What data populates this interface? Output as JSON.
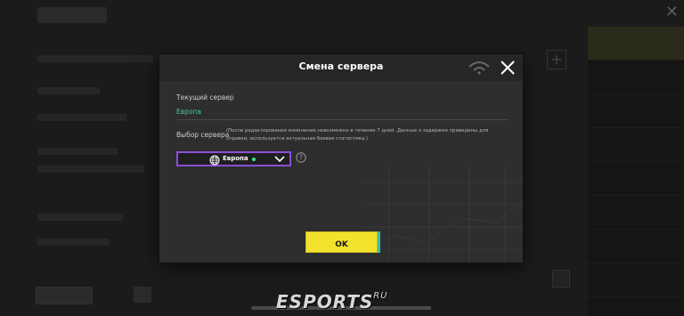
{
  "dialog": {
    "title": "Смена сервера",
    "current_server_label": "Текущий сервер",
    "current_server_value": "Европа",
    "server_select_label": "Выбор сервера",
    "server_select_note": "(После редактирования изменение невозможно в течение 7 дней. Данные о задержке приведены для справки; используется актуальная боевая статистика.)",
    "selected_server": "Европа",
    "ok_label": "OK"
  },
  "colors": {
    "accent_select_border": "#8a4fd8",
    "current_server_text": "#41d28c",
    "ok_button": "#f2e22c",
    "status_dot": "#3fe08a"
  },
  "icons": [
    "close-icon",
    "wifi-icon",
    "globe-icon",
    "chevron-down-icon",
    "help-icon"
  ]
}
